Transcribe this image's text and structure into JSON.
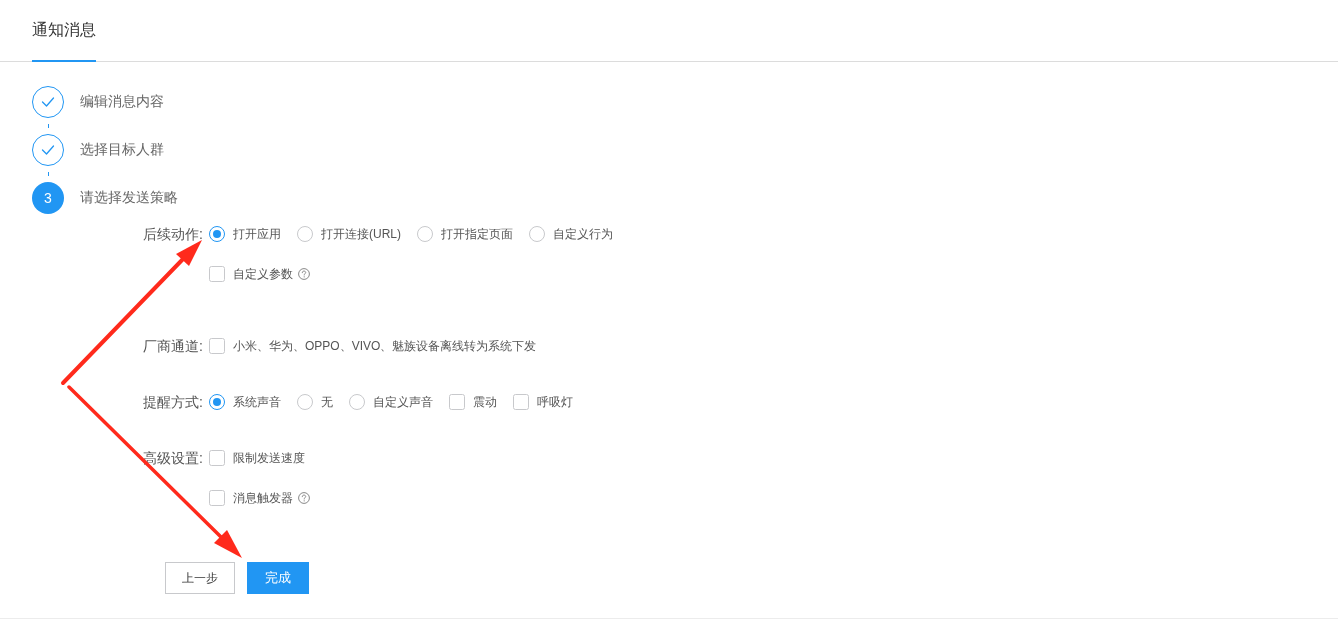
{
  "tabs": [
    {
      "label": "通知消息",
      "selected": true
    }
  ],
  "steps": [
    {
      "label": "编辑消息内容",
      "completed": true,
      "active": false
    },
    {
      "label": "选择目标人群",
      "completed": true,
      "active": false
    },
    {
      "label": "请选择发送策略",
      "completed": false,
      "active": true,
      "number": "3"
    }
  ],
  "form": [
    {
      "label": "后续动作:",
      "lines": [
        {
          "options": [
            {
              "kind": "radio",
              "label": "打开应用",
              "selected": true
            },
            {
              "kind": "radio",
              "label": "打开连接(URL)",
              "selected": false
            },
            {
              "kind": "radio",
              "label": "打开指定页面",
              "selected": false
            },
            {
              "kind": "radio",
              "label": "自定义行为",
              "selected": false
            }
          ]
        },
        {
          "options": [
            {
              "kind": "checkbox",
              "label": "自定义参数",
              "checked": false,
              "help": true
            }
          ]
        }
      ]
    },
    {
      "label": "厂商通道:",
      "lines": [
        {
          "options": [
            {
              "kind": "checkbox",
              "label": "小米、华为、OPPO、VIVO、魅族设备离线转为系统下发",
              "checked": false
            }
          ]
        }
      ]
    },
    {
      "label": "提醒方式:",
      "lines": [
        {
          "options": [
            {
              "kind": "radio",
              "label": "系统声音",
              "selected": true
            },
            {
              "kind": "radio",
              "label": "无",
              "selected": false
            },
            {
              "kind": "radio",
              "label": "自定义声音",
              "selected": false
            },
            {
              "kind": "checkbox",
              "label": "震动",
              "checked": false
            },
            {
              "kind": "checkbox",
              "label": "呼吸灯",
              "checked": false
            }
          ]
        }
      ]
    },
    {
      "label": "高级设置:",
      "lines": [
        {
          "options": [
            {
              "kind": "checkbox",
              "label": "限制发送速度",
              "checked": false
            }
          ]
        },
        {
          "options": [
            {
              "kind": "checkbox",
              "label": "消息触发器",
              "checked": false,
              "help": true
            }
          ]
        }
      ]
    }
  ],
  "buttons": [
    {
      "label": "上一步",
      "kind": "secondary"
    },
    {
      "label": "完成",
      "kind": "primary"
    }
  ]
}
